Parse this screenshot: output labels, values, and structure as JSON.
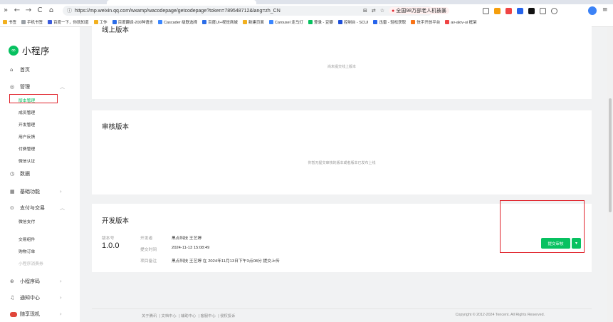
{
  "browser": {
    "url": "https://mp.weixin.qq.com/wxamp/wacodepage/getcodepage?token=789548712&lang=zh_CN",
    "nav": {
      "more": "»",
      "back": "←",
      "forward": "→",
      "reload": "C",
      "home": "⌂"
    },
    "extension_text": "全国98万部老人机被暴",
    "bookmarks": [
      {
        "label": "书签",
        "color": "#f2b01e"
      },
      {
        "label": "手机书签",
        "color": "#9aa0a6"
      },
      {
        "label": "百度一下，你就知道",
        "color": "#3b5bdb"
      },
      {
        "label": "工作",
        "color": "#f2b01e"
      },
      {
        "label": "百度翻译-200种语言",
        "color": "#2b6de8"
      },
      {
        "label": "Cascader 级联选择",
        "color": "#3a86ff"
      },
      {
        "label": "百度UI+视觉商城",
        "color": "#2b6de8"
      },
      {
        "label": "新建页面",
        "color": "#f2b01e"
      },
      {
        "label": "Carousel 走马灯",
        "color": "#3a86ff"
      },
      {
        "label": "登录 - 豆瓣",
        "color": "#07c160"
      },
      {
        "label": "控制台 - SCUI",
        "color": "#1d4ed8"
      },
      {
        "label": "迅雷 - 轻松获取",
        "color": "#2563eb"
      },
      {
        "label": "快手开放平台",
        "color": "#f97316"
      },
      {
        "label": "av-alov-ui 框架",
        "color": "#ef4444"
      }
    ]
  },
  "sidebar": {
    "logo": "小程序",
    "home": "首页",
    "manage": "管理",
    "manage_items": [
      "版本管理",
      "成员管理",
      "开发管理",
      "用户反馈",
      "付费管理",
      "微信认证"
    ],
    "data": "数据",
    "basic": "基础功能",
    "pay": "支付与交易",
    "pay_items": [
      "微信支付",
      "交易组件",
      "购物订单",
      "小程序消费券"
    ],
    "code": "小程序码",
    "notify": "通知中心",
    "gift": "随享现机"
  },
  "main": {
    "online": {
      "title": "线上版本",
      "empty": "尚未提交线上版本"
    },
    "review": {
      "title": "审核版本",
      "empty": "你暂无提交审核的版本或者版本已发布上线"
    },
    "dev": {
      "title": "开发版本",
      "version_label": "版本号",
      "version": "1.0.0",
      "developer_label": "开发者",
      "developer": "黑点科技 王艺婷",
      "time_label": "提交时间",
      "time": "2024-11-13 15:08:49",
      "note_label": "项目备注",
      "note": "黑点科技 王艺婷 在 2024年11月13日下午3点08分 提交上传",
      "submit": "提交审核",
      "dropdown": "▾"
    }
  },
  "footer": {
    "links": [
      "关于腾讯",
      "文档中心",
      "辅助中心",
      "客服中心",
      "侵权投诉"
    ],
    "copyright": "Copyright © 2012-2024 Tencent. All Rights Reserved."
  },
  "colors": {
    "accent": "#07c160",
    "highlight": "#e0232b"
  }
}
